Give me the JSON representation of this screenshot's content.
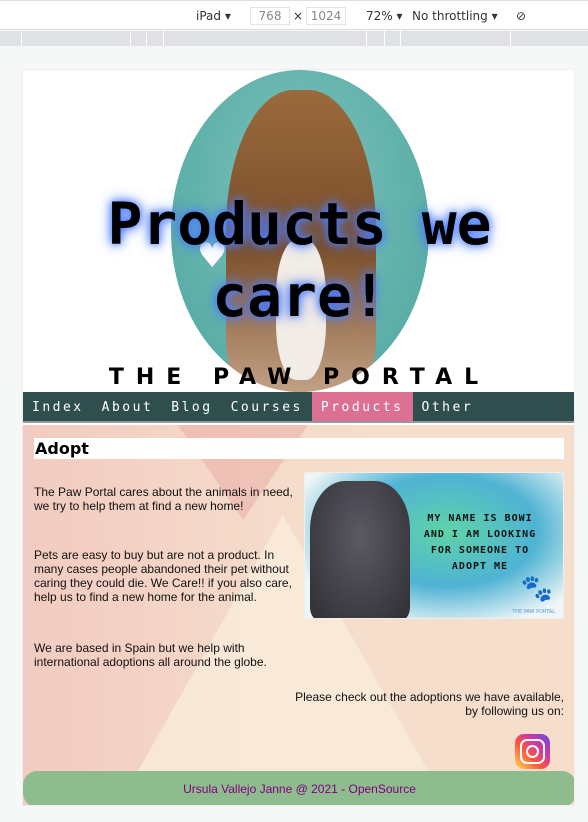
{
  "devtools": {
    "device": "iPad",
    "width": "768",
    "height": "1024",
    "times": "×",
    "zoom": "72%",
    "throttling": "No throttling",
    "rotate_icon": "rotate-icon"
  },
  "header": {
    "title": "Products we care!",
    "brand": "THE PAW PORTAL"
  },
  "nav": {
    "items": [
      {
        "label": "Index"
      },
      {
        "label": "About"
      },
      {
        "label": "Blog"
      },
      {
        "label": "Courses"
      },
      {
        "label": "Products",
        "active": true
      },
      {
        "label": "Other"
      }
    ],
    "bg": "#2f4f4f",
    "active_bg": "#db7093"
  },
  "main": {
    "heading": "Adopt",
    "paragraphs": [
      "The Paw Portal cares about the animals in need, we try to help them at find a new home!",
      "Pets are easy to buy but are not a product. In many cases people abandoned their pet without caring they could die. We Care!! if you also care, help us to find a new home for the animal.",
      "We are based in Spain but we help with international adoptions all around the globe."
    ],
    "image_text": "MY NAME IS BOWI AND I AM LOOKING FOR SOMEONE TO ADOPT ME",
    "image_logo": "THE PAW PORTAL",
    "check_line1": "Please check out the adoptions we have available,",
    "check_line2": "by following us on:",
    "social_icon": "instagram-icon"
  },
  "footer": {
    "text": "Ursula Vallejo Janne @ 2021 - OpenSource",
    "bg": "#8fbc8f",
    "color": "#800080"
  }
}
